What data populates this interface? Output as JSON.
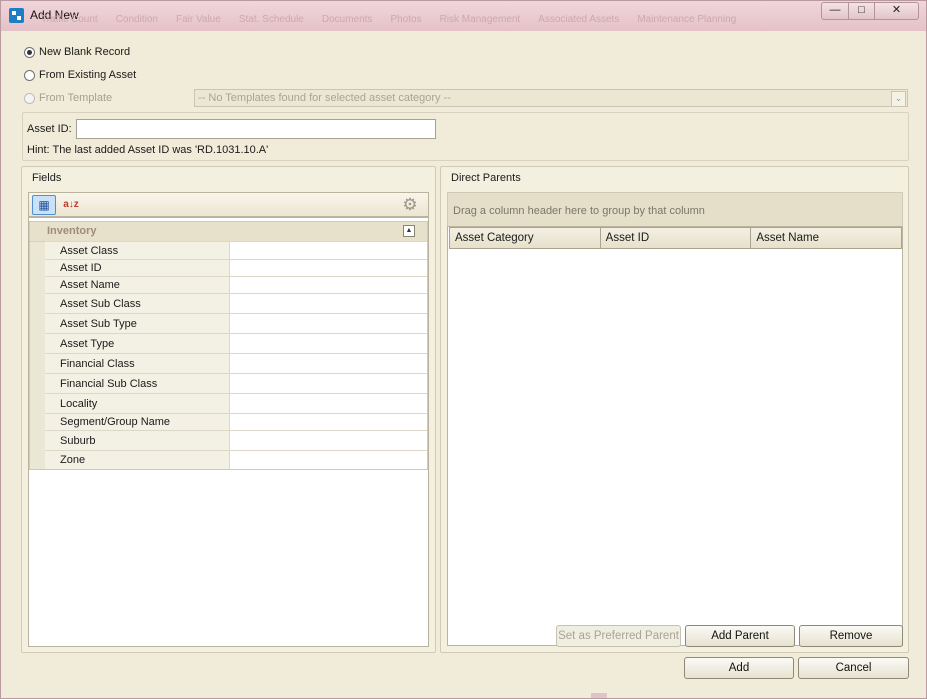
{
  "window": {
    "title": "Add New",
    "ghost_tabs": [
      "Traffic Count",
      "Condition",
      "Fair Value",
      "Stat. Schedule",
      "Documents",
      "Photos",
      "Risk Management",
      "Associated Assets",
      "Maintenance Planning"
    ],
    "controls": {
      "minimize": "—",
      "maximize": "□",
      "close": "✕"
    }
  },
  "source": {
    "options": [
      {
        "label": "New Blank Record",
        "checked": true,
        "disabled": false
      },
      {
        "label": "From Existing Asset",
        "checked": false,
        "disabled": false
      },
      {
        "label": "From Template",
        "checked": false,
        "disabled": true
      }
    ],
    "template_placeholder": "-- No Templates found for selected asset category --",
    "template_chevron": "⌄"
  },
  "asset_id": {
    "label": "Asset ID:",
    "value": "",
    "hint": "Hint: The last added Asset ID was 'RD.1031.10.A'"
  },
  "fields": {
    "title": "Fields",
    "toolbar": {
      "categorized_icon": "▦",
      "alphabetical_icon": "a↓z",
      "settings_icon": "⚙"
    },
    "category": "Inventory",
    "collapse_glyph": "▲",
    "properties": [
      {
        "name": "Asset Class",
        "value": ""
      },
      {
        "name": "Asset ID",
        "value": ""
      },
      {
        "name": "Asset Name",
        "value": ""
      },
      {
        "name": "Asset Sub Class",
        "value": ""
      },
      {
        "name": "Asset Sub Type",
        "value": ""
      },
      {
        "name": "Asset Type",
        "value": ""
      },
      {
        "name": "Financial Class",
        "value": ""
      },
      {
        "name": "Financial Sub Class",
        "value": ""
      },
      {
        "name": "Locality",
        "value": ""
      },
      {
        "name": "Segment/Group Name",
        "value": ""
      },
      {
        "name": "Suburb",
        "value": ""
      },
      {
        "name": "Zone",
        "value": ""
      }
    ]
  },
  "parents": {
    "title": "Direct Parents",
    "group_hint": "Drag a column header here to group by that column",
    "columns": [
      "Asset Category",
      "Asset ID",
      "Asset Name"
    ],
    "buttons": {
      "preferred": "Set as Preferred Parent",
      "add": "Add Parent",
      "remove": "Remove"
    }
  },
  "footer": {
    "add": "Add",
    "cancel": "Cancel"
  }
}
